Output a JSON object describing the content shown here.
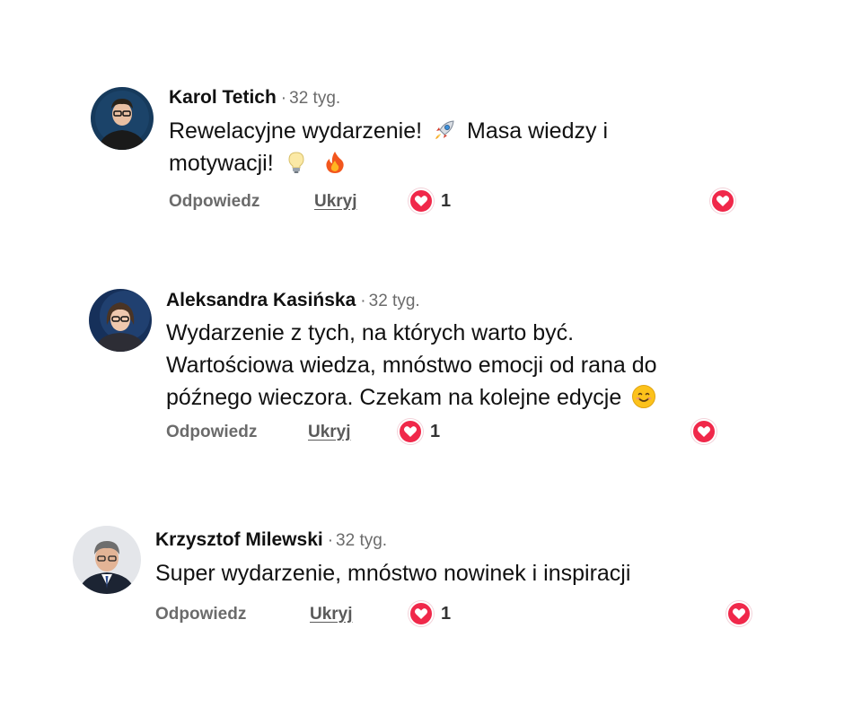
{
  "actions": {
    "reply_label": "Odpowiedz",
    "hide_label": "Ukryj"
  },
  "colors": {
    "heart": "#f0284a",
    "meta": "#6b6b6b"
  },
  "comments": [
    {
      "author": "Karol Tetich",
      "separator": "·",
      "time": "32 tyg.",
      "lines": [
        {
          "a": "Rewelacyjne wydarzenie!",
          "emoji1": "rocket-emoji",
          "b": "Masa wiedzy i"
        },
        {
          "a": "motywacji!",
          "emoji1": "lightbulb-emoji",
          "emoji2": "fire-emoji"
        }
      ],
      "reaction_count": "1"
    },
    {
      "author": "Aleksandra Kasińska",
      "separator": "·",
      "time": "32 tyg.",
      "lines": [
        {
          "a": "Wydarzenie z tych, na których warto być."
        },
        {
          "a": "Wartościowa wiedza, mnóstwo emocji od rana do"
        },
        {
          "a": "późnego wieczora. Czekam na kolejne edycje",
          "emoji1": "smiling-face-emoji"
        }
      ],
      "reaction_count": "1"
    },
    {
      "author": "Krzysztof Milewski",
      "separator": "·",
      "time": "32 tyg.",
      "lines": [
        {
          "a": "Super wydarzenie, mnóstwo nowinek i inspiracji"
        }
      ],
      "reaction_count": "1"
    }
  ]
}
